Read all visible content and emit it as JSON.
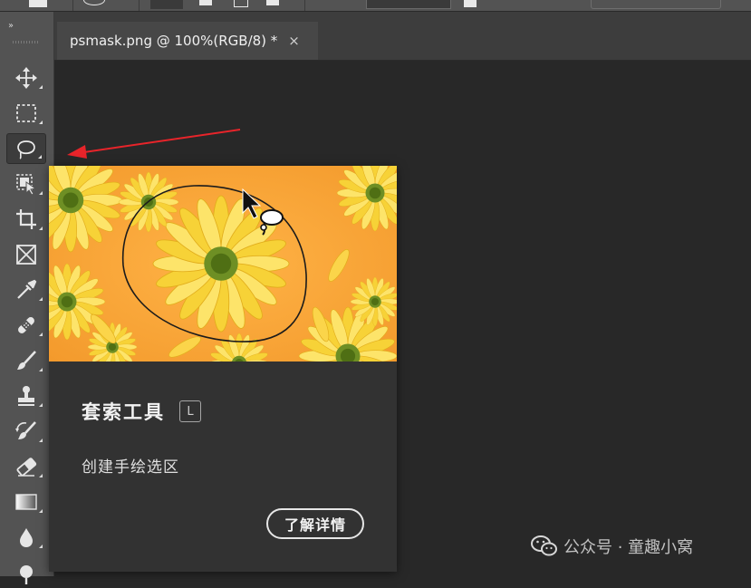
{
  "document_tab": {
    "title": "psmask.png @ 100%(RGB/8) *",
    "close_glyph": "×"
  },
  "toolbar": {
    "collapse_glyph": "››",
    "tools": [
      {
        "name": "move-tool",
        "icon": "move-icon"
      },
      {
        "name": "rectangular-marquee-tool",
        "icon": "marquee-icon"
      },
      {
        "name": "lasso-tool",
        "icon": "lasso-icon",
        "active": true
      },
      {
        "name": "object-selection-tool",
        "icon": "object-selection-icon"
      },
      {
        "name": "crop-tool",
        "icon": "crop-icon"
      },
      {
        "name": "frame-tool",
        "icon": "frame-icon"
      },
      {
        "name": "eyedropper-tool",
        "icon": "eyedropper-icon"
      },
      {
        "name": "healing-brush-tool",
        "icon": "bandage-icon"
      },
      {
        "name": "brush-tool",
        "icon": "brush-icon"
      },
      {
        "name": "clone-stamp-tool",
        "icon": "stamp-icon"
      },
      {
        "name": "history-brush-tool",
        "icon": "history-brush-icon"
      },
      {
        "name": "eraser-tool",
        "icon": "eraser-icon"
      },
      {
        "name": "gradient-tool",
        "icon": "gradient-icon"
      },
      {
        "name": "blur-tool",
        "icon": "drop-icon"
      },
      {
        "name": "dodge-tool",
        "icon": "dodge-icon"
      }
    ]
  },
  "tooltip": {
    "title": "套索工具",
    "shortcut": "L",
    "description": "创建手绘选区",
    "learn_more": "了解详情"
  },
  "watermark": {
    "text": "公众号 · 童趣小窝"
  },
  "colors": {
    "accent_arrow": "#e8242a",
    "panel_bg": "#323232",
    "toolbar_bg": "#535353",
    "canvas_bg": "#282828",
    "preview_orange": "#f7a43a"
  }
}
